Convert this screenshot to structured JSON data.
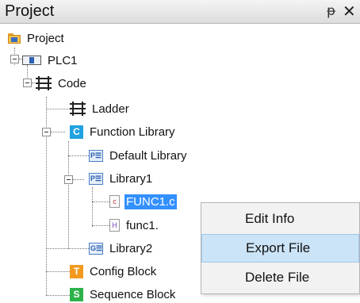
{
  "panel": {
    "title": "Project",
    "pin_glyph": "ᵽ",
    "close_glyph": "✕"
  },
  "tree": {
    "root": "Project",
    "plc": "PLC1",
    "code": "Code",
    "ladder": "Ladder",
    "function_library": "Function Library",
    "default_library": "Default Library",
    "library1": "Library1",
    "func1_c": "FUNC1.c",
    "func1_h": "func1.",
    "library2": "Library2",
    "config_block": "Config Block",
    "sequence_block": "Sequence Block"
  },
  "icons": {
    "function_library_badge": "C",
    "config_block_badge": "T",
    "sequence_block_badge": "S",
    "lib_badge": "P☰",
    "lib2_badge": "G☰",
    "c_file": "c",
    "h_file": "H"
  },
  "context_menu": {
    "items": [
      "Edit Info",
      "Export File",
      "Delete File"
    ],
    "highlighted": "Export File"
  },
  "colors": {
    "selection": "#3390ff",
    "menu_hover": "#cce4f7"
  }
}
